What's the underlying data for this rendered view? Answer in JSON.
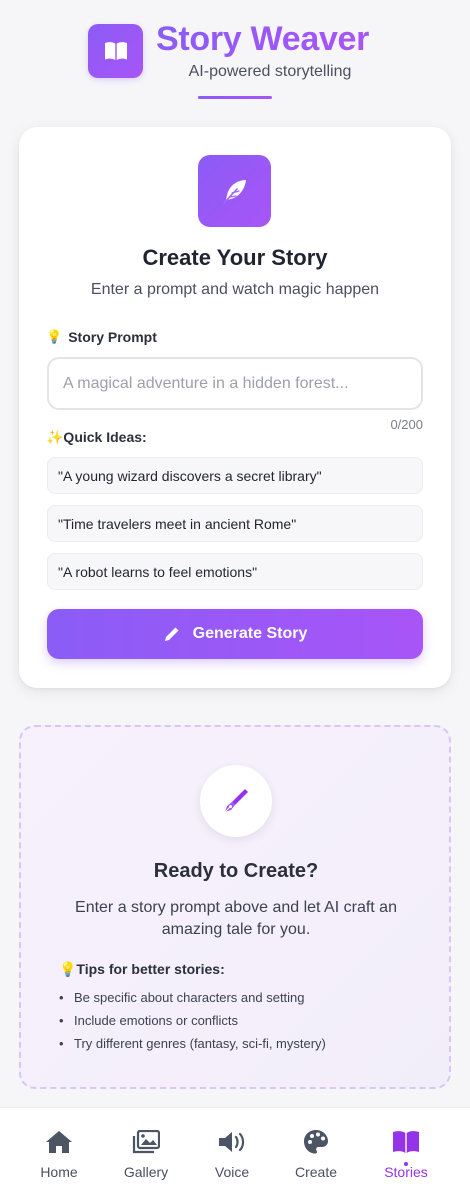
{
  "header": {
    "title": "Story Weaver",
    "subtitle": "AI-powered storytelling",
    "logo_icon": "open-book-icon"
  },
  "create": {
    "icon": "feather-icon",
    "title": "Create Your Story",
    "subtitle": "Enter a prompt and watch magic happen",
    "prompt_label_icon": "💡",
    "prompt_label": "Story Prompt",
    "prompt_placeholder": "A magical adventure in a hidden forest...",
    "prompt_value": "",
    "char_count": "0/200",
    "ideas_label": "✨Quick Ideas:",
    "ideas": [
      "\"A young wizard discovers a secret library\"",
      "\"Time travelers meet in ancient Rome\"",
      "\"A robot learns to feel emotions\""
    ],
    "generate_label": "Generate Story",
    "generate_icon": "pencil-icon"
  },
  "ready": {
    "icon": "fountain-pen-icon",
    "title": "Ready to Create?",
    "description": "Enter a story prompt above and let AI craft an amazing tale for you.",
    "tips_label": "💡Tips for better stories:",
    "tips": [
      "Be specific about characters and setting",
      "Include emotions or conflicts",
      "Try different genres (fantasy, sci-fi, mystery)"
    ]
  },
  "nav": {
    "items": [
      {
        "label": "Home",
        "icon": "home-icon"
      },
      {
        "label": "Gallery",
        "icon": "images-icon"
      },
      {
        "label": "Voice",
        "icon": "speaker-icon"
      },
      {
        "label": "Create",
        "icon": "palette-icon"
      },
      {
        "label": "Stories",
        "icon": "book-icon",
        "active": true
      }
    ]
  },
  "colors": {
    "accent": "#8b5cf6",
    "accent_end": "#a855f7",
    "active_nav": "#9333ea",
    "nav_icon": "#4b5563"
  }
}
